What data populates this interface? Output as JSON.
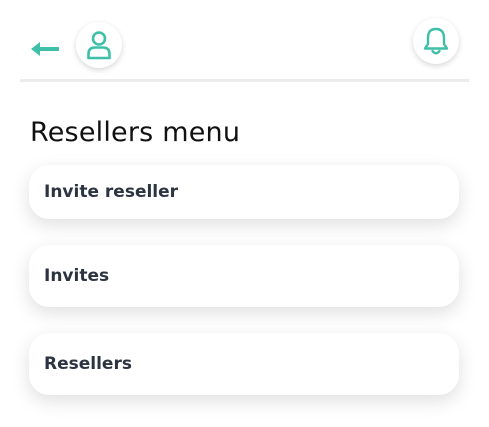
{
  "header": {
    "back_icon": "arrow-left-icon",
    "profile_icon": "user-icon",
    "notification_icon": "bell-icon"
  },
  "page": {
    "title": "Resellers menu"
  },
  "menu": {
    "items": [
      {
        "label": "Invite reseller"
      },
      {
        "label": "Invites"
      },
      {
        "label": "Resellers"
      }
    ]
  },
  "colors": {
    "accent": "#3dbfa8",
    "text": "#2b3440",
    "divider": "#ececec"
  }
}
